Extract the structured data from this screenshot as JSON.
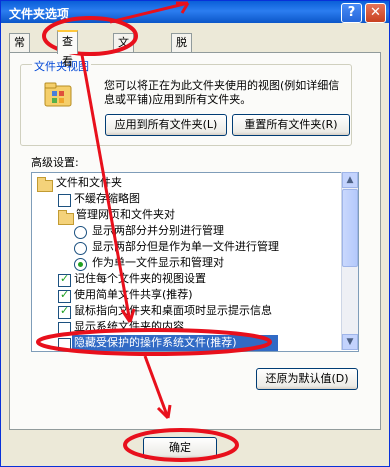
{
  "window": {
    "title": "文件夹选项"
  },
  "titlebar": {
    "help_glyph": "?",
    "close_glyph": "✕"
  },
  "tabs": [
    "常规",
    "查看",
    "文件类型",
    "脱机文件"
  ],
  "folder_views": {
    "group_title": "文件夹视图",
    "description": "您可以将正在为此文件夹使用的视图(例如详细信息或平铺)应用到所有文件夹。",
    "apply_all_label": "应用到所有文件夹(L)",
    "reset_all_label": "重置所有文件夹(R)"
  },
  "advanced": {
    "label": "高级设置:",
    "items": [
      {
        "type": "folder",
        "label": "文件和文件夹"
      },
      {
        "type": "checkbox",
        "checked": false,
        "label": "不缓存缩略图"
      },
      {
        "type": "folder",
        "label": "管理网页和文件夹对"
      },
      {
        "type": "radio",
        "checked": false,
        "label": "显示两部分并分别进行管理"
      },
      {
        "type": "radio",
        "checked": false,
        "label": "显示两部分但是作为单一文件进行管理"
      },
      {
        "type": "radio",
        "checked": true,
        "label": "作为单一文件显示和管理对"
      },
      {
        "type": "checkbox",
        "checked": true,
        "label": "记住每个文件夹的视图设置"
      },
      {
        "type": "checkbox",
        "checked": true,
        "label": "使用简单文件共享(推荐)"
      },
      {
        "type": "checkbox",
        "checked": true,
        "label": "鼠标指向文件夹和桌面项时显示提示信息"
      },
      {
        "type": "checkbox",
        "checked": false,
        "label": "显示系统文件夹的内容"
      },
      {
        "type": "checkbox",
        "checked": false,
        "label": "隐藏受保护的操作系统文件(推荐)"
      }
    ],
    "scroll_up_glyph": "▲",
    "scroll_down_glyph": "▼"
  },
  "restore_defaults_label": "还原为默认值(D)",
  "ok_label": "确定",
  "colors": {
    "annotation": "#e8101c",
    "selection": "#316ac5",
    "titlebar": "#0a5fd8"
  }
}
